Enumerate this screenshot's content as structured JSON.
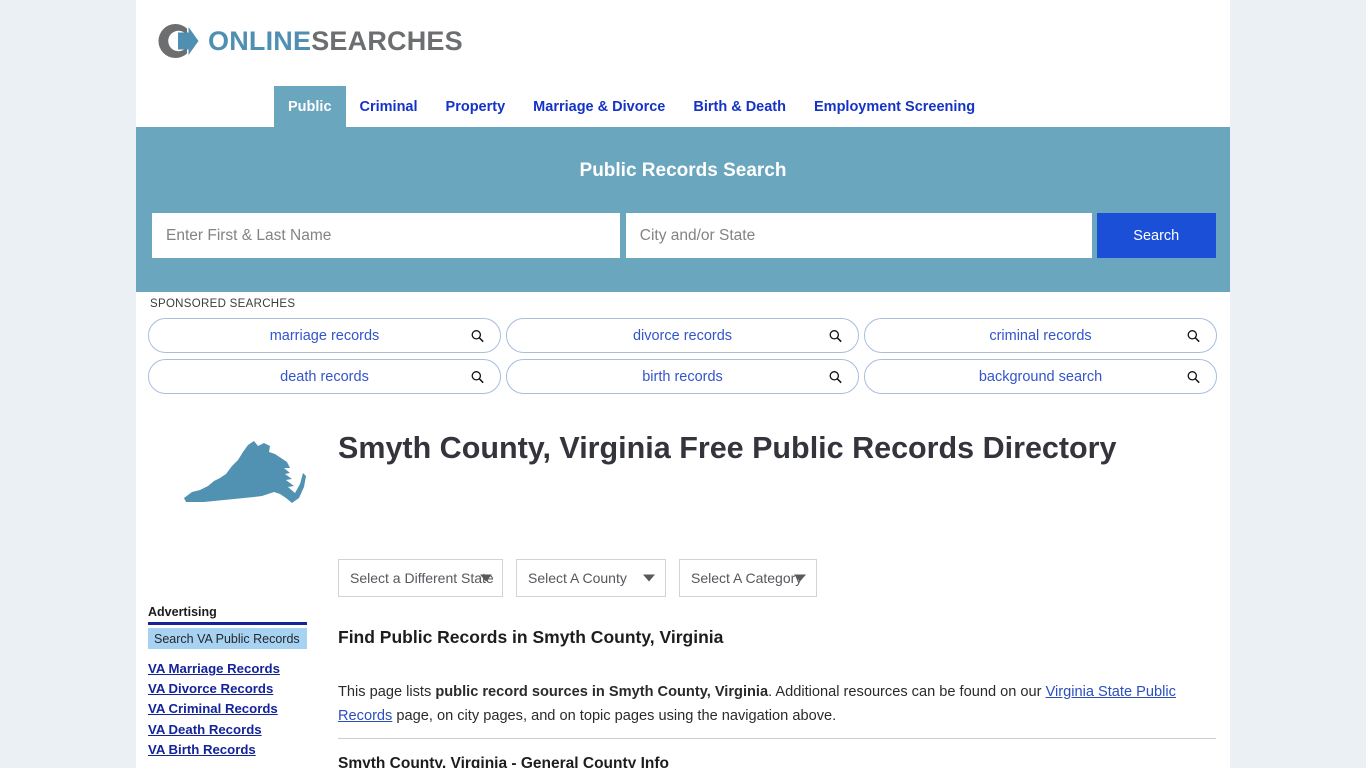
{
  "brand": {
    "name_part1": "ONLINE",
    "name_part2": "SEARCHES",
    "icon": "circle-arrow-logo-icon",
    "accent_blue": "#4f90b2",
    "accent_gray": "#6d6e70"
  },
  "nav": {
    "items": [
      {
        "label": "Public",
        "active": true
      },
      {
        "label": "Criminal",
        "active": false
      },
      {
        "label": "Property",
        "active": false
      },
      {
        "label": "Marriage & Divorce",
        "active": false
      },
      {
        "label": "Birth & Death",
        "active": false
      },
      {
        "label": "Employment Screening",
        "active": false
      }
    ]
  },
  "hero": {
    "title": "Public Records Search",
    "name_placeholder": "Enter First & Last Name",
    "name_value": "",
    "city_placeholder": "City and/or State",
    "city_value": "",
    "search_label": "Search",
    "background_color": "#6aa6be",
    "button_color": "#1b4fd8"
  },
  "sponsored": {
    "label": "SPONSORED SEARCHES",
    "chips": [
      {
        "label": "marriage records",
        "icon": "search-icon"
      },
      {
        "label": "divorce records",
        "icon": "search-icon"
      },
      {
        "label": "criminal records",
        "icon": "search-icon"
      },
      {
        "label": "death records",
        "icon": "search-icon"
      },
      {
        "label": "birth records",
        "icon": "search-icon"
      },
      {
        "label": "background search",
        "icon": "search-icon"
      }
    ]
  },
  "page": {
    "title": "Smyth County, Virginia Free Public Records Directory",
    "state_map_icon": "virginia-state-map-icon",
    "state_map_color": "#5192b3"
  },
  "selects": [
    {
      "label": "Select a Different State",
      "icon": "chevron-down-icon"
    },
    {
      "label": "Select A County",
      "icon": "chevron-down-icon"
    },
    {
      "label": "Select A Category",
      "icon": "chevron-down-icon"
    }
  ],
  "content": {
    "section_heading": "Find Public Records in Smyth County, Virginia",
    "paragraph_part1": "This page lists ",
    "paragraph_bold": "public record sources in Smyth County, Virginia",
    "paragraph_part2": ". Additional resources can be found on our ",
    "paragraph_link": "Virginia State Public Records",
    "paragraph_part3": " page, on city pages, and on topic pages using the navigation above.",
    "table_heading": "Smyth County, Virginia - General County Info"
  },
  "sidebar": {
    "advertising_label": "Advertising",
    "ad_button_label": "Search VA Public Records",
    "links": [
      "VA Marriage Records",
      "VA Divorce Records",
      "VA Criminal Records",
      "VA Death Records",
      "VA Birth Records"
    ]
  }
}
